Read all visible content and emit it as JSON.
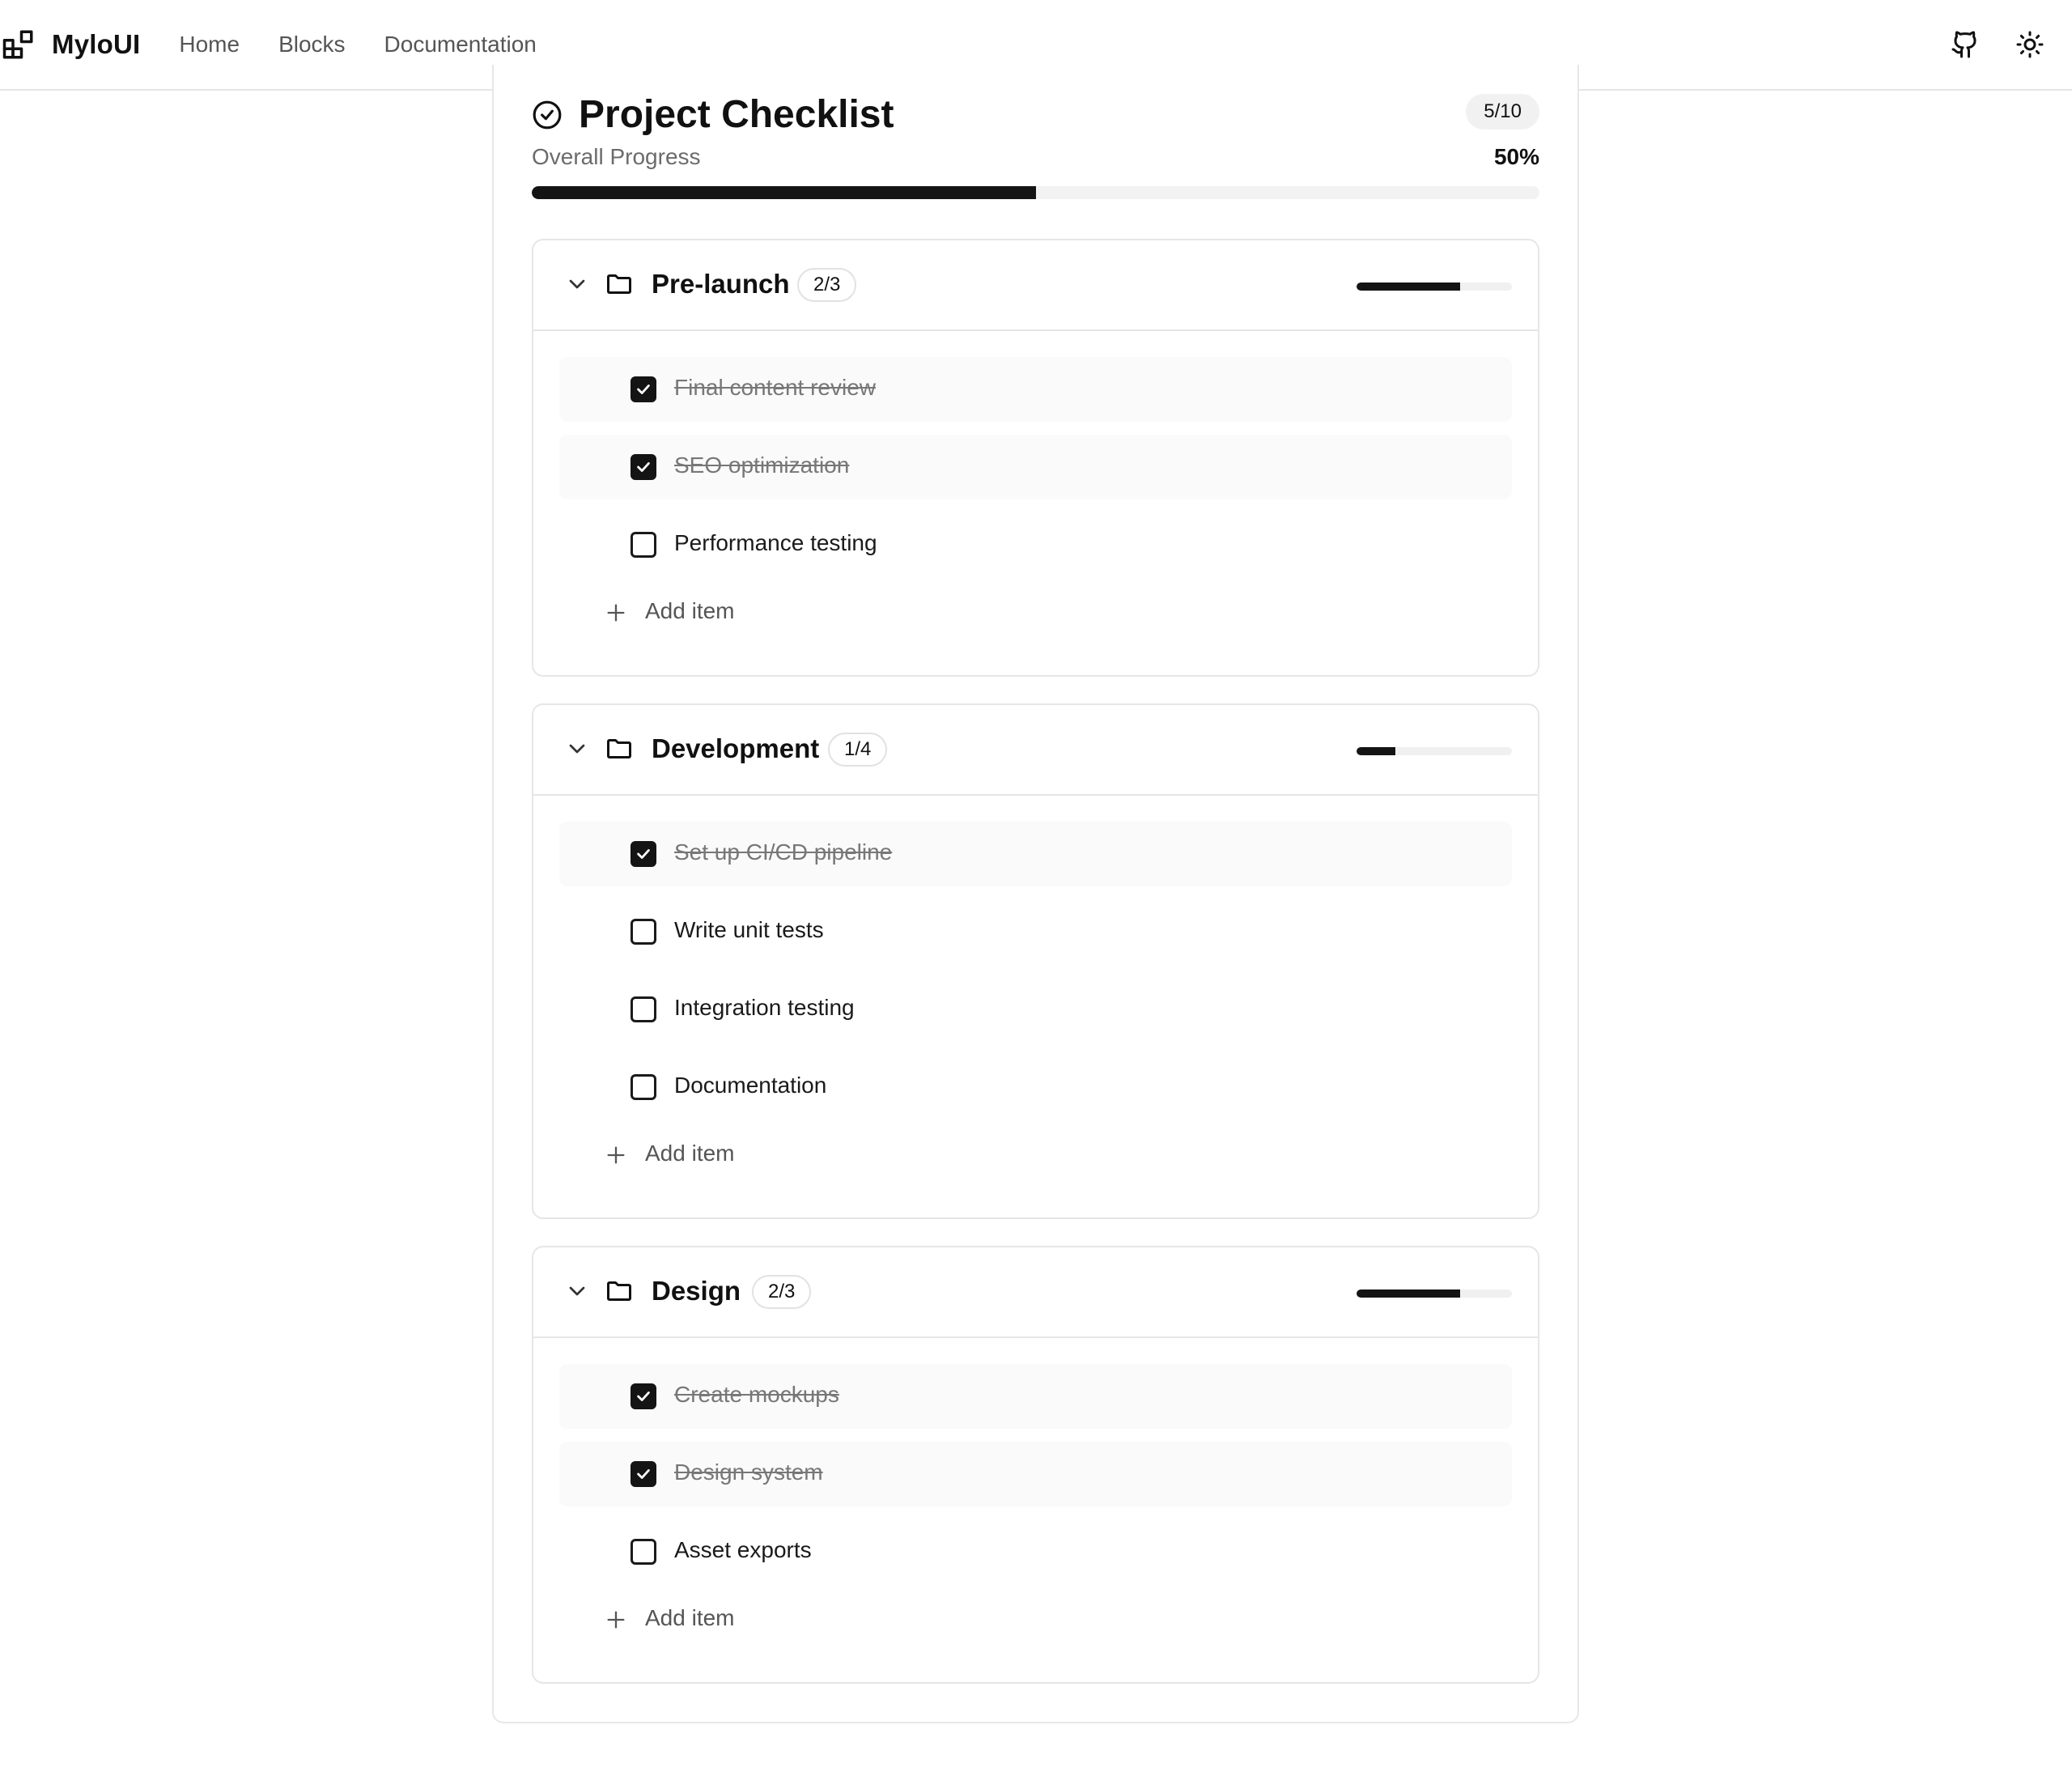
{
  "nav": {
    "brand": "MyloUI",
    "links": [
      "Home",
      "Blocks",
      "Documentation"
    ],
    "icons": [
      "github-icon",
      "sun-icon"
    ]
  },
  "checklist": {
    "title": "Project Checklist",
    "count": "5/10",
    "overall_label": "Overall Progress",
    "overall_percent": "50%",
    "overall_progress": 0.5,
    "add_label": "Add item",
    "sections": [
      {
        "name": "Pre-launch",
        "count": "2/3",
        "progress": 0.6667,
        "items": [
          {
            "label": "Final content review",
            "done": true
          },
          {
            "label": "SEO optimization",
            "done": true
          },
          {
            "label": "Performance testing",
            "done": false
          }
        ]
      },
      {
        "name": "Development",
        "count": "1/4",
        "progress": 0.25,
        "items": [
          {
            "label": "Set up CI/CD pipeline",
            "done": true
          },
          {
            "label": "Write unit tests",
            "done": false
          },
          {
            "label": "Integration testing",
            "done": false
          },
          {
            "label": "Documentation",
            "done": false
          }
        ]
      },
      {
        "name": "Design",
        "count": "2/3",
        "progress": 0.6667,
        "items": [
          {
            "label": "Create mockups",
            "done": true
          },
          {
            "label": "Design system",
            "done": true
          },
          {
            "label": "Asset exports",
            "done": false
          }
        ]
      }
    ]
  },
  "colors": {
    "accent": "#141414",
    "track": "#f0f0f0",
    "border": "#e6e6e6",
    "muted_text": "#777777"
  }
}
